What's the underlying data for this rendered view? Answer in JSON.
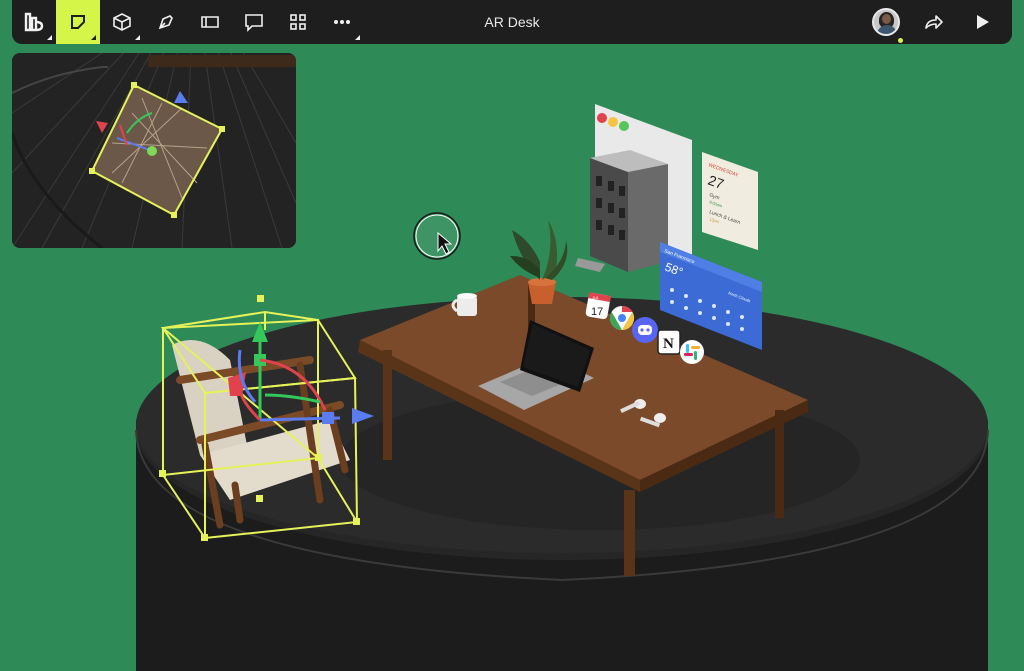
{
  "toolbar": {
    "title": "AR Desk",
    "tools": [
      {
        "name": "logo-menu-icon",
        "active": false
      },
      {
        "name": "select-tool-icon",
        "active": true
      },
      {
        "name": "3d-object-tool-icon",
        "active": false
      },
      {
        "name": "pen-tool-icon",
        "active": false
      },
      {
        "name": "frame-tool-icon",
        "active": false
      },
      {
        "name": "comment-tool-icon",
        "active": false
      },
      {
        "name": "components-grid-icon",
        "active": false
      },
      {
        "name": "more-options-icon",
        "active": false
      }
    ],
    "right": [
      "avatar",
      "share-icon",
      "play-icon"
    ]
  },
  "widgets": {
    "calendar": {
      "day": "WEDNESDAY",
      "date": "27",
      "event1": "Gym",
      "event1_time": "9:00am",
      "event2": "Lunch & Learn",
      "event2_time": "12pm"
    },
    "weather": {
      "city": "San Francisco",
      "temp": "58°",
      "location2": "North Clouds"
    },
    "cal_icon": {
      "month": "JUL",
      "date": "17"
    }
  },
  "colors": {
    "background": "#2e8b57",
    "toolbar": "#1e1e1e",
    "accent": "#d6f549",
    "selection": "#e5f25a",
    "gizmo_x": "#e0434b",
    "gizmo_y": "#34c759",
    "gizmo_z": "#5b7cf0"
  }
}
